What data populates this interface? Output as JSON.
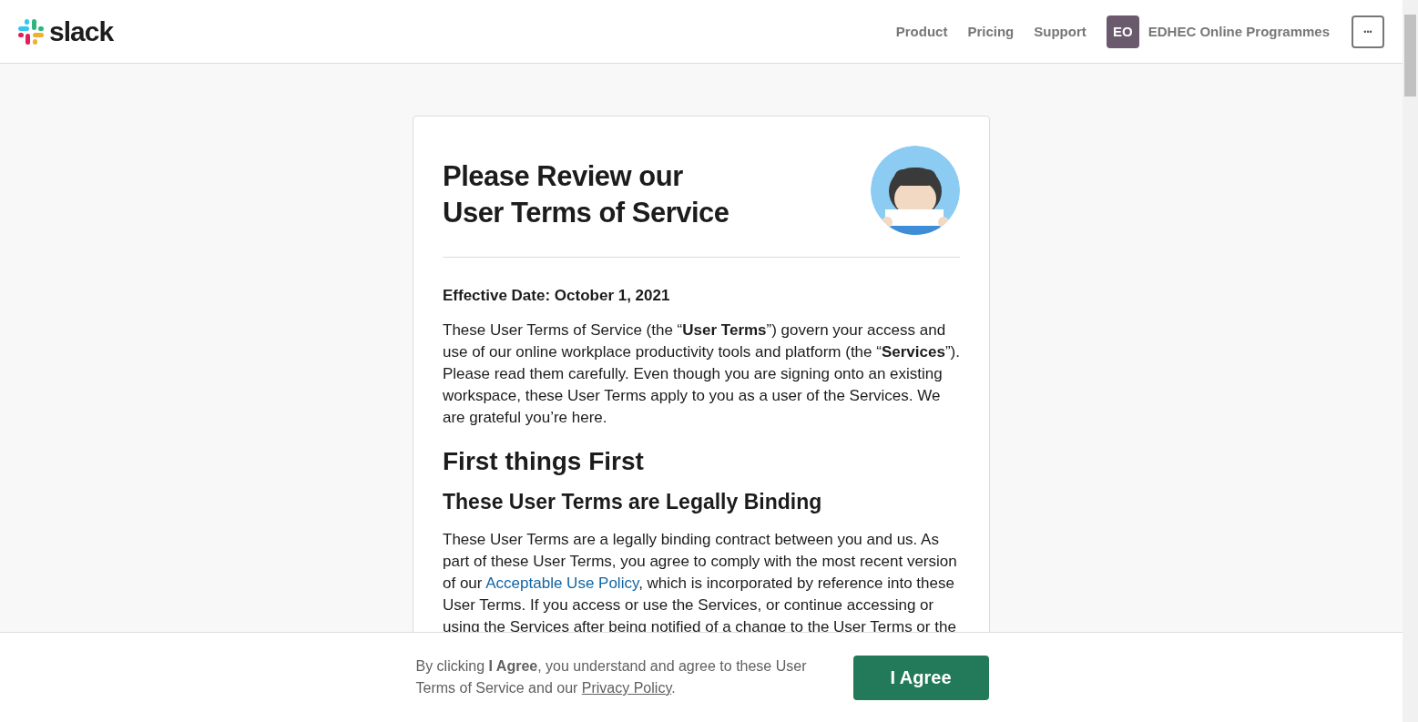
{
  "header": {
    "logo": "slack",
    "nav": [
      "Product",
      "Pricing",
      "Support"
    ],
    "workspace": {
      "initials": "EO",
      "name": "EDHEC Online Programmes"
    },
    "more_button": "•••"
  },
  "card": {
    "title_lines": [
      "Please Review our",
      "User Terms of Service"
    ],
    "illustration": {
      "kind": "picture"
    },
    "effective_date": "Effective Date: October 1, 2021",
    "intro": "These User Terms of Service (the “**User Terms**”) govern your access and use of our online workplace productivity tools and platform (the “**Services**”). Please read them carefully. Even though you are signing onto an existing workspace, these User Terms apply to you as a user of the Services. We are grateful you’re here.",
    "heading": "First things First",
    "subheading": "These User Terms are Legally Binding",
    "binding": {
      "before": "These User Terms are a legally binding contract between you and us. As part of these User Terms, you agree to comply with the most recent version of our ",
      "link": "Acceptable Use Policy",
      "after": ", which is incorporated by reference into these User Terms. If you access or use the Services, or continue accessing or using the Services after being notified of a change to the User Terms or the"
    }
  },
  "footer": {
    "consent_before": "By clicking **I Agree**, you understand and agree to these User Terms of Service and our ",
    "consent_link": "Privacy Policy",
    "consent_after": ".",
    "agree_button": "I Agree"
  }
}
